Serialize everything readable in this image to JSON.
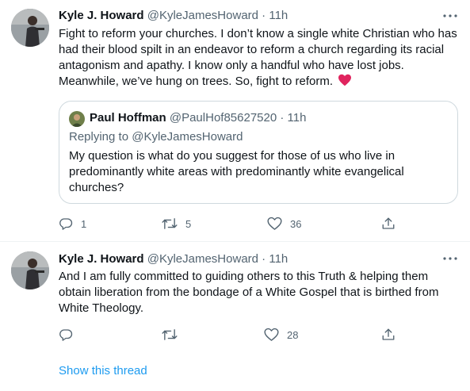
{
  "tweets": [
    {
      "name": "Kyle J. Howard",
      "handle": "@KyleJamesHoward",
      "separator": "·",
      "time": "11h",
      "text": "Fight to reform your churches. I don’t know a single white Christian who has had their blood spilt in an endeavor to reform a church regarding its racial antagonism and apathy. I know only a handful who have lost jobs. Meanwhile, we’ve hung on trees. So, fight to reform.",
      "emoji": "red-heart",
      "quote": {
        "name": "Paul Hoffman",
        "handle": "@PaulHof85627520",
        "separator": "·",
        "time": "11h",
        "replying_to": "Replying to @KyleJamesHoward",
        "text": "My question is what do you suggest for those of us who live in predominantly white areas with predominantly white evangelical churches?"
      },
      "counts": {
        "replies": "1",
        "retweets": "5",
        "likes": "36"
      }
    },
    {
      "name": "Kyle J. Howard",
      "handle": "@KyleJamesHoward",
      "separator": "·",
      "time": "11h",
      "text": "And I am fully committed to guiding others to this Truth & helping them obtain liberation from the bondage of a White Gospel that is birthed from White Theology.",
      "counts": {
        "likes": "28"
      },
      "show_thread": "Show this thread"
    }
  ],
  "icons": {
    "reply": "reply-icon",
    "retweet": "retweet-icon",
    "like": "heart-icon",
    "share": "share-icon",
    "more": "more-icon"
  },
  "colors": {
    "link": "#1d9bf0",
    "secondary": "#536471",
    "border": "#cfd9de",
    "heart": "#f91880"
  }
}
